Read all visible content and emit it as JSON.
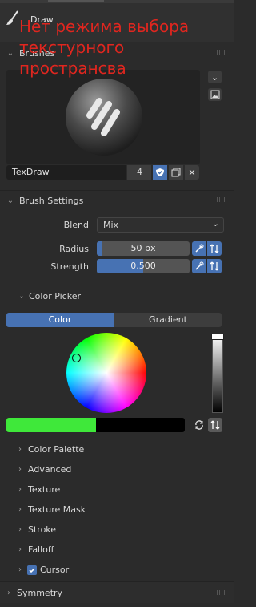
{
  "topbar": {
    "tool_name": "Draw"
  },
  "overlay_note": "Нет режима выбора текстурного пространсва",
  "brushes": {
    "header": "Brushes",
    "brush_name": "TexDraw",
    "user_count": "4"
  },
  "brush_settings": {
    "header": "Brush Settings",
    "blend_label": "Blend",
    "blend_value": "Mix",
    "radius_label": "Radius",
    "radius_value": "50 px",
    "radius_fraction": 0.05,
    "strength_label": "Strength",
    "strength_value": "0.500",
    "strength_fraction": 0.5
  },
  "color_picker": {
    "header": "Color Picker",
    "tab_color": "Color",
    "tab_gradient": "Gradient",
    "value_fraction": 1.0,
    "swatch_color": "#3fe83a"
  },
  "subpanels": [
    {
      "label": "Color Palette"
    },
    {
      "label": "Advanced"
    },
    {
      "label": "Texture"
    },
    {
      "label": "Texture Mask"
    },
    {
      "label": "Stroke"
    },
    {
      "label": "Falloff"
    },
    {
      "label": "Cursor",
      "checked": true
    }
  ],
  "symmetry": {
    "header": "Symmetry"
  },
  "colors": {
    "accent": "#4772b3",
    "overlay_text": "#e0261f",
    "panel_bg": "#2b2b2b",
    "header_bg": "#303030"
  }
}
